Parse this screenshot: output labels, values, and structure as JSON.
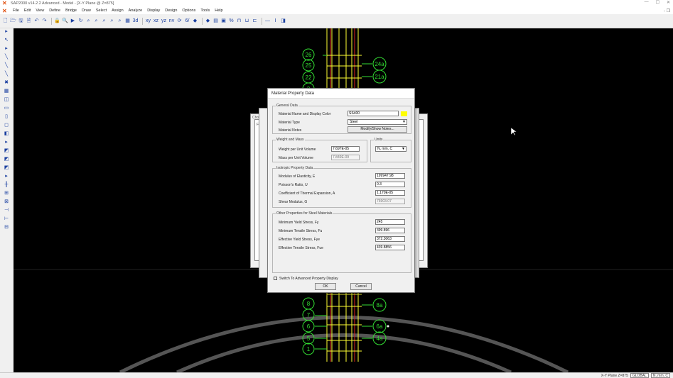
{
  "window": {
    "title": "SAP2000 v14.2.2 Advanced - Model - [X-Y Plane @ Z=875]",
    "controls": [
      "—",
      "☐",
      "✕"
    ]
  },
  "menubar": {
    "items": [
      "File",
      "Edit",
      "View",
      "Define",
      "Bridge",
      "Draw",
      "Select",
      "Assign",
      "Analyze",
      "Display",
      "Design",
      "Options",
      "Tools",
      "Help"
    ],
    "mdi_controls": "- ❐"
  },
  "toolbar": {
    "zoom_label": "3-d",
    "glyphs": [
      "🗋",
      "🗁",
      "🖫",
      "🗎",
      "↶",
      "↷",
      "🔒",
      "🔍",
      "▶",
      "↻",
      "⌕",
      "⌕",
      "⌕",
      "⌕",
      "⌕",
      "▦",
      "3d",
      "xy",
      "xz",
      "yz",
      "nv",
      "⟳",
      "6/",
      "◆",
      "◆",
      "▤",
      "▣",
      "%",
      "⊓",
      "⊔",
      "⊏",
      "—",
      "I",
      "◨"
    ]
  },
  "lefttoolbar": {
    "glyphs": [
      "▸",
      "↖",
      "▸",
      "╲",
      "╲",
      "╲",
      "✖",
      "▦",
      "◫",
      "▭",
      "▯",
      "◻",
      "◧",
      "▸",
      "◩",
      "◩",
      "◩",
      "▸",
      "╫",
      "⊞",
      "⊠",
      "⊣",
      "⊢",
      "⊟"
    ]
  },
  "statusbar": {
    "coordinate": "X-Y Plane  Z=875",
    "coord_system": "GLOBAL",
    "units": "N, mm, C"
  },
  "canvas": {
    "grid_bubbles_left": [
      "26",
      "25",
      "22",
      "2",
      "8",
      "7",
      "6",
      "5",
      "1"
    ],
    "grid_bubbles_right": [
      "24a",
      "21a",
      "8a",
      "6a",
      "4a"
    ]
  },
  "dialog": {
    "title": "Material Property Data",
    "general": {
      "heading": "General Data",
      "name_label": "Material Name and Display Color",
      "name_value": "SS400",
      "name_color": "#ffff00",
      "type_label": "Material Type",
      "type_value": "Steel",
      "notes_label": "Material Notes",
      "notes_button": "Modify/Show Notes..."
    },
    "weight": {
      "heading": "Weight and Mass",
      "weight_label": "Weight per Unit Volume",
      "weight_value": "7.697E-05",
      "mass_label": "Mass per Unit Volume",
      "mass_value": "7.849E-09"
    },
    "units": {
      "heading": "Units",
      "value": "N, mm, C"
    },
    "isotropic": {
      "heading": "Isotropic Property Data",
      "e_label": "Modulus of Elasticity, E",
      "e_value": "199947.98",
      "u_label": "Poisson's Ratio, U",
      "u_value": "0.3",
      "a_label": "Coefficient of Thermal Expansion, A",
      "a_value": "1.170E-05",
      "g_label": "Shear Modulus, G",
      "g_value": "76903.07"
    },
    "other": {
      "heading": "Other Properties for Steel Materials",
      "fy_label": "Minimum Yield Stress, Fy",
      "fy_value": "245",
      "fu_label": "Minimum Tensile Stress, Fu",
      "fu_value": "399.896",
      "fye_label": "Effective Yield Stress, Fye",
      "fye_value": "372.3063",
      "fue_label": "Effective Tensile Stress, Fue",
      "fue_value": "439.8856"
    },
    "advanced_label": "Switch To Advanced Property Display",
    "ok": "OK",
    "cancel": "Cancel"
  },
  "back_dialog": {
    "tab_label": "Choo",
    "side_label": "Fi"
  }
}
